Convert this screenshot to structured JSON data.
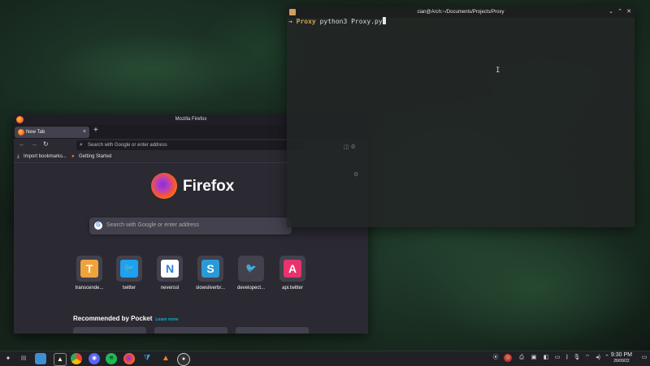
{
  "firefox": {
    "window_title": "Mozilla Firefox",
    "tab_label": "New Tab",
    "tab_close": "×",
    "new_tab": "+",
    "back": "←",
    "forward": "→",
    "reload": "↻",
    "url_placeholder": "Search with Google or enter address",
    "bookmarks": [
      "Import bookmarks...",
      "Getting Started"
    ],
    "brand": "Firefox",
    "search_placeholder": "Search with Google or enter address",
    "top_sites": [
      {
        "name": "transcende...",
        "letter": "T",
        "color": "#f0a33b"
      },
      {
        "name": "twitter",
        "letter": "🐦",
        "color": "#1da1f2"
      },
      {
        "name": "neverssl",
        "letter": "N",
        "color": "#2a82da"
      },
      {
        "name": "slowsilverbr...",
        "letter": "S",
        "color": "#2a9ad6"
      },
      {
        "name": "developect...",
        "letter": "🐦",
        "color": "#1da1f2"
      },
      {
        "name": "api.twitter",
        "letter": "A",
        "color": "#e8336d"
      }
    ],
    "pocket_heading": "Recommended by Pocket",
    "pocket_link": "Learn more"
  },
  "terminal": {
    "title": "cian@Arch:~/Documents/Projects/Proxy",
    "prompt_arrow": "→",
    "cwd": "Proxy",
    "command": "python3 Proxy.py",
    "minimize": "⌄",
    "maximize": "⌃",
    "close": "✕"
  },
  "taskbar": {
    "time": "9:30 PM",
    "date": "26/09/22",
    "apps": [
      "app-launcher",
      "pager",
      "file-manager",
      "terminal",
      "chrome",
      "discord",
      "spotify",
      "firefox",
      "vscode",
      "vlc",
      "obs"
    ],
    "tray": [
      "record",
      "vpn",
      "printer",
      "clipboard",
      "battery",
      "bluetooth",
      "microphone",
      "wifi",
      "volume",
      "expand"
    ]
  }
}
